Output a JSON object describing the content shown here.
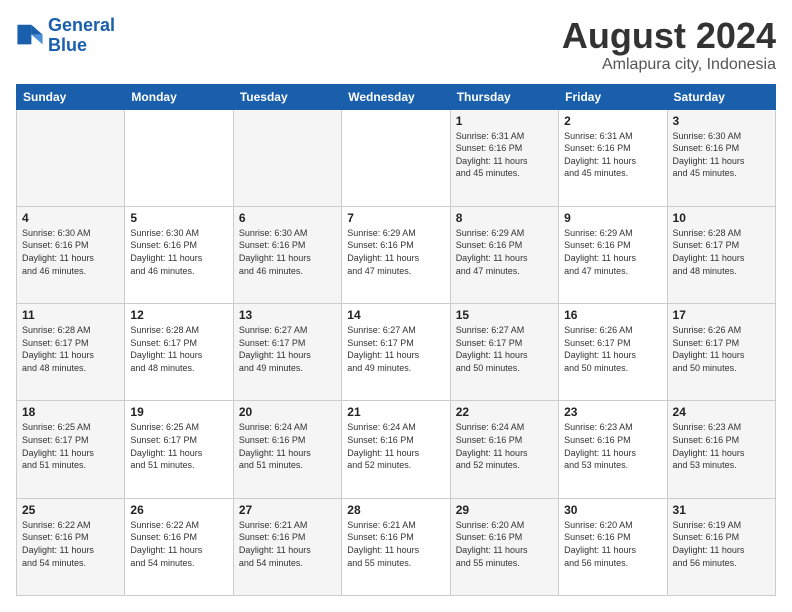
{
  "logo": {
    "line1": "General",
    "line2": "Blue"
  },
  "title": "August 2024",
  "subtitle": "Amlapura city, Indonesia",
  "days_header": [
    "Sunday",
    "Monday",
    "Tuesday",
    "Wednesday",
    "Thursday",
    "Friday",
    "Saturday"
  ],
  "weeks": [
    [
      {
        "day": "",
        "info": ""
      },
      {
        "day": "",
        "info": ""
      },
      {
        "day": "",
        "info": ""
      },
      {
        "day": "",
        "info": ""
      },
      {
        "day": "1",
        "info": "Sunrise: 6:31 AM\nSunset: 6:16 PM\nDaylight: 11 hours\nand 45 minutes."
      },
      {
        "day": "2",
        "info": "Sunrise: 6:31 AM\nSunset: 6:16 PM\nDaylight: 11 hours\nand 45 minutes."
      },
      {
        "day": "3",
        "info": "Sunrise: 6:30 AM\nSunset: 6:16 PM\nDaylight: 11 hours\nand 45 minutes."
      }
    ],
    [
      {
        "day": "4",
        "info": "Sunrise: 6:30 AM\nSunset: 6:16 PM\nDaylight: 11 hours\nand 46 minutes."
      },
      {
        "day": "5",
        "info": "Sunrise: 6:30 AM\nSunset: 6:16 PM\nDaylight: 11 hours\nand 46 minutes."
      },
      {
        "day": "6",
        "info": "Sunrise: 6:30 AM\nSunset: 6:16 PM\nDaylight: 11 hours\nand 46 minutes."
      },
      {
        "day": "7",
        "info": "Sunrise: 6:29 AM\nSunset: 6:16 PM\nDaylight: 11 hours\nand 47 minutes."
      },
      {
        "day": "8",
        "info": "Sunrise: 6:29 AM\nSunset: 6:16 PM\nDaylight: 11 hours\nand 47 minutes."
      },
      {
        "day": "9",
        "info": "Sunrise: 6:29 AM\nSunset: 6:16 PM\nDaylight: 11 hours\nand 47 minutes."
      },
      {
        "day": "10",
        "info": "Sunrise: 6:28 AM\nSunset: 6:17 PM\nDaylight: 11 hours\nand 48 minutes."
      }
    ],
    [
      {
        "day": "11",
        "info": "Sunrise: 6:28 AM\nSunset: 6:17 PM\nDaylight: 11 hours\nand 48 minutes."
      },
      {
        "day": "12",
        "info": "Sunrise: 6:28 AM\nSunset: 6:17 PM\nDaylight: 11 hours\nand 48 minutes."
      },
      {
        "day": "13",
        "info": "Sunrise: 6:27 AM\nSunset: 6:17 PM\nDaylight: 11 hours\nand 49 minutes."
      },
      {
        "day": "14",
        "info": "Sunrise: 6:27 AM\nSunset: 6:17 PM\nDaylight: 11 hours\nand 49 minutes."
      },
      {
        "day": "15",
        "info": "Sunrise: 6:27 AM\nSunset: 6:17 PM\nDaylight: 11 hours\nand 50 minutes."
      },
      {
        "day": "16",
        "info": "Sunrise: 6:26 AM\nSunset: 6:17 PM\nDaylight: 11 hours\nand 50 minutes."
      },
      {
        "day": "17",
        "info": "Sunrise: 6:26 AM\nSunset: 6:17 PM\nDaylight: 11 hours\nand 50 minutes."
      }
    ],
    [
      {
        "day": "18",
        "info": "Sunrise: 6:25 AM\nSunset: 6:17 PM\nDaylight: 11 hours\nand 51 minutes."
      },
      {
        "day": "19",
        "info": "Sunrise: 6:25 AM\nSunset: 6:17 PM\nDaylight: 11 hours\nand 51 minutes."
      },
      {
        "day": "20",
        "info": "Sunrise: 6:24 AM\nSunset: 6:16 PM\nDaylight: 11 hours\nand 51 minutes."
      },
      {
        "day": "21",
        "info": "Sunrise: 6:24 AM\nSunset: 6:16 PM\nDaylight: 11 hours\nand 52 minutes."
      },
      {
        "day": "22",
        "info": "Sunrise: 6:24 AM\nSunset: 6:16 PM\nDaylight: 11 hours\nand 52 minutes."
      },
      {
        "day": "23",
        "info": "Sunrise: 6:23 AM\nSunset: 6:16 PM\nDaylight: 11 hours\nand 53 minutes."
      },
      {
        "day": "24",
        "info": "Sunrise: 6:23 AM\nSunset: 6:16 PM\nDaylight: 11 hours\nand 53 minutes."
      }
    ],
    [
      {
        "day": "25",
        "info": "Sunrise: 6:22 AM\nSunset: 6:16 PM\nDaylight: 11 hours\nand 54 minutes."
      },
      {
        "day": "26",
        "info": "Sunrise: 6:22 AM\nSunset: 6:16 PM\nDaylight: 11 hours\nand 54 minutes."
      },
      {
        "day": "27",
        "info": "Sunrise: 6:21 AM\nSunset: 6:16 PM\nDaylight: 11 hours\nand 54 minutes."
      },
      {
        "day": "28",
        "info": "Sunrise: 6:21 AM\nSunset: 6:16 PM\nDaylight: 11 hours\nand 55 minutes."
      },
      {
        "day": "29",
        "info": "Sunrise: 6:20 AM\nSunset: 6:16 PM\nDaylight: 11 hours\nand 55 minutes."
      },
      {
        "day": "30",
        "info": "Sunrise: 6:20 AM\nSunset: 6:16 PM\nDaylight: 11 hours\nand 56 minutes."
      },
      {
        "day": "31",
        "info": "Sunrise: 6:19 AM\nSunset: 6:16 PM\nDaylight: 11 hours\nand 56 minutes."
      }
    ]
  ]
}
